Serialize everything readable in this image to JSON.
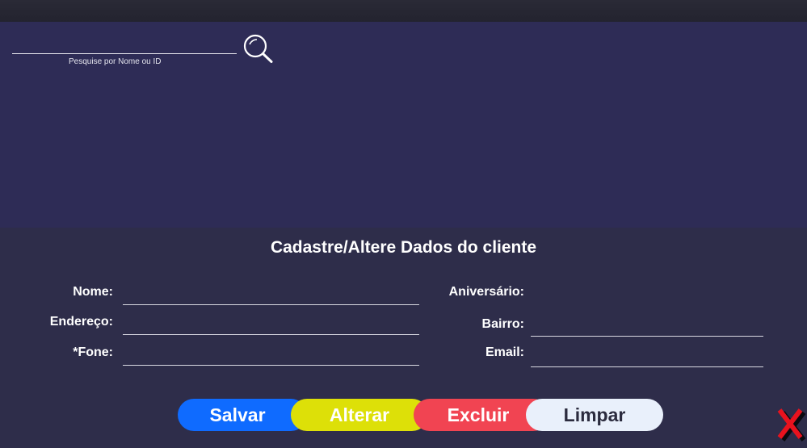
{
  "search": {
    "value": "",
    "hint": "Pesquise por Nome ou ID",
    "icon": "search-icon"
  },
  "form": {
    "title": "Cadastre/Altere Dados do cliente",
    "fields": {
      "nome": {
        "label": "Nome:",
        "value": ""
      },
      "endereco": {
        "label": "Endereço:",
        "value": ""
      },
      "fone": {
        "label": "*Fone:",
        "value": ""
      },
      "aniversario": {
        "label": "Aniversário:",
        "value": ""
      },
      "bairro": {
        "label": "Bairro:",
        "value": ""
      },
      "email": {
        "label": "Email:",
        "value": ""
      }
    }
  },
  "buttons": {
    "salvar": "Salvar",
    "alterar": "Alterar",
    "excluir": "Excluir",
    "limpar": "Limpar"
  },
  "colors": {
    "background": "#2e2d4a",
    "results_panel": "#2e2c56",
    "salvar": "#0f6bff",
    "alterar": "#dde008",
    "excluir": "#f14452",
    "limpar": "#e9f0fb",
    "close": "#e8121e"
  },
  "close_icon": "close-icon"
}
